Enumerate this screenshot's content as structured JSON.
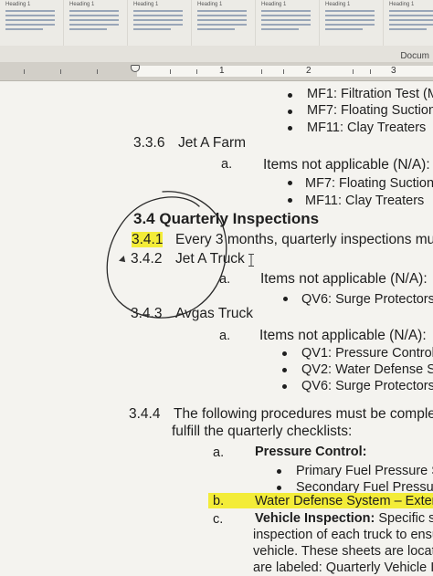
{
  "styles_gallery": {
    "tiles": [
      {
        "name": "Heading 1"
      },
      {
        "name": "Heading 1"
      },
      {
        "name": "Heading 1"
      },
      {
        "name": "Heading 1"
      },
      {
        "name": "Heading 1"
      },
      {
        "name": "Heading 1"
      },
      {
        "name": "Heading 1"
      }
    ]
  },
  "document_tab": "Docum",
  "ruler": {
    "numbers": [
      "1",
      "2",
      "3"
    ]
  },
  "doc": {
    "mf1": "MF1: Filtration Test (Mil",
    "mf7_a": "MF7: Floating Suction",
    "mf11_a": "MF11: Clay Treaters",
    "s336_num": "3.3.6",
    "s336_title": "Jet A Farm",
    "s336_a": "a.",
    "s336_a_text": "Items not applicable (N/A):",
    "mf7_b": "MF7: Floating Suction",
    "mf11_b": "MF11: Clay Treaters",
    "s34": "3.4 Quarterly Inspections",
    "s341_num": "3.4.1",
    "s341_text": "Every 3 months, quarterly inspections mu",
    "s342_num": "3.4.2",
    "s342_title": "Jet A Truck",
    "s342_a": "a.",
    "s342_a_text": "Items not applicable (N/A):",
    "qv6_a": "QV6: Surge Protectors",
    "s343_num": "3.4.3",
    "s343_title": "Avgas Truck",
    "s343_a": "a.",
    "s343_a_text": "Items not applicable (N/A):",
    "qv1": "QV1: Pressure Control",
    "qv2": "QV2: Water Defense Syst",
    "qv6_b": "QV6: Surge Protectors",
    "s344_num": "3.4.4",
    "s344_line1": "The following procedures must be comple",
    "s344_line2": "fulfill the quarterly checklists:",
    "s344_a": "a.",
    "s344_a_text": "Pressure Control:",
    "pfp": "Primary Fuel Pressure Set",
    "sfp": "Secondary Fuel Pressure S",
    "s344_b": "b.",
    "s344_b_text": "Water Defense System – Exterr",
    "s344_c": "c.",
    "s344_c_bold": "Vehicle Inspection:",
    "s344_c_rest": " Specific s",
    "s344_c_line2": "inspection of each truck to ensu",
    "s344_c_line3": "vehicle. These sheets are locate",
    "s344_c_line4": "are labeled: Quarterly Vehicle In"
  },
  "colors": {
    "highlight": "#f3ec38",
    "page": "#f4f3ef",
    "pen": "#2a2a2a"
  }
}
